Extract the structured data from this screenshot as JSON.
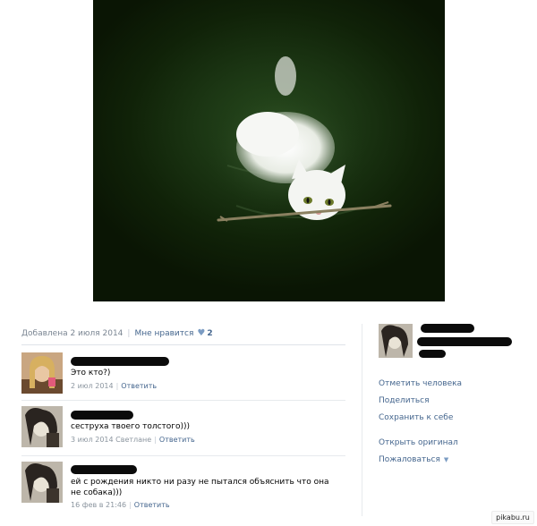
{
  "photo": {
    "alt": "white cat swimming with stick",
    "colors": {
      "water": "#1c3714",
      "cat": "#f2f4f0"
    }
  },
  "meta": {
    "added": "Добавлена 2 июля 2014",
    "like_label": "Мне нравится",
    "like_icon": "heart-icon",
    "like_count": "2"
  },
  "comments": [
    {
      "text": "Это кто?)",
      "date": "2 июл 2014",
      "reply_to": "",
      "reply": "Ответить"
    },
    {
      "text": "сеструха твоего толстого)))",
      "date": "3 июл 2014",
      "reply_to": "Светлане",
      "reply": "Ответить"
    },
    {
      "text": "ей с рождения никто ни разу не пытался объяснить что она не собака)))",
      "date": "16 фев в 21:46",
      "reply_to": "",
      "reply": "Ответить"
    }
  ],
  "actions": {
    "tag": "Отметить человека",
    "share": "Поделиться",
    "save": "Сохранить к себе",
    "original": "Открыть оригинал",
    "report": "Пожаловаться",
    "report_icon": "chevron-down-icon"
  },
  "watermark": "pikabu.ru",
  "colors": {
    "link": "#45668e",
    "muted": "#7a8592",
    "heart": "#7b9cc3"
  }
}
